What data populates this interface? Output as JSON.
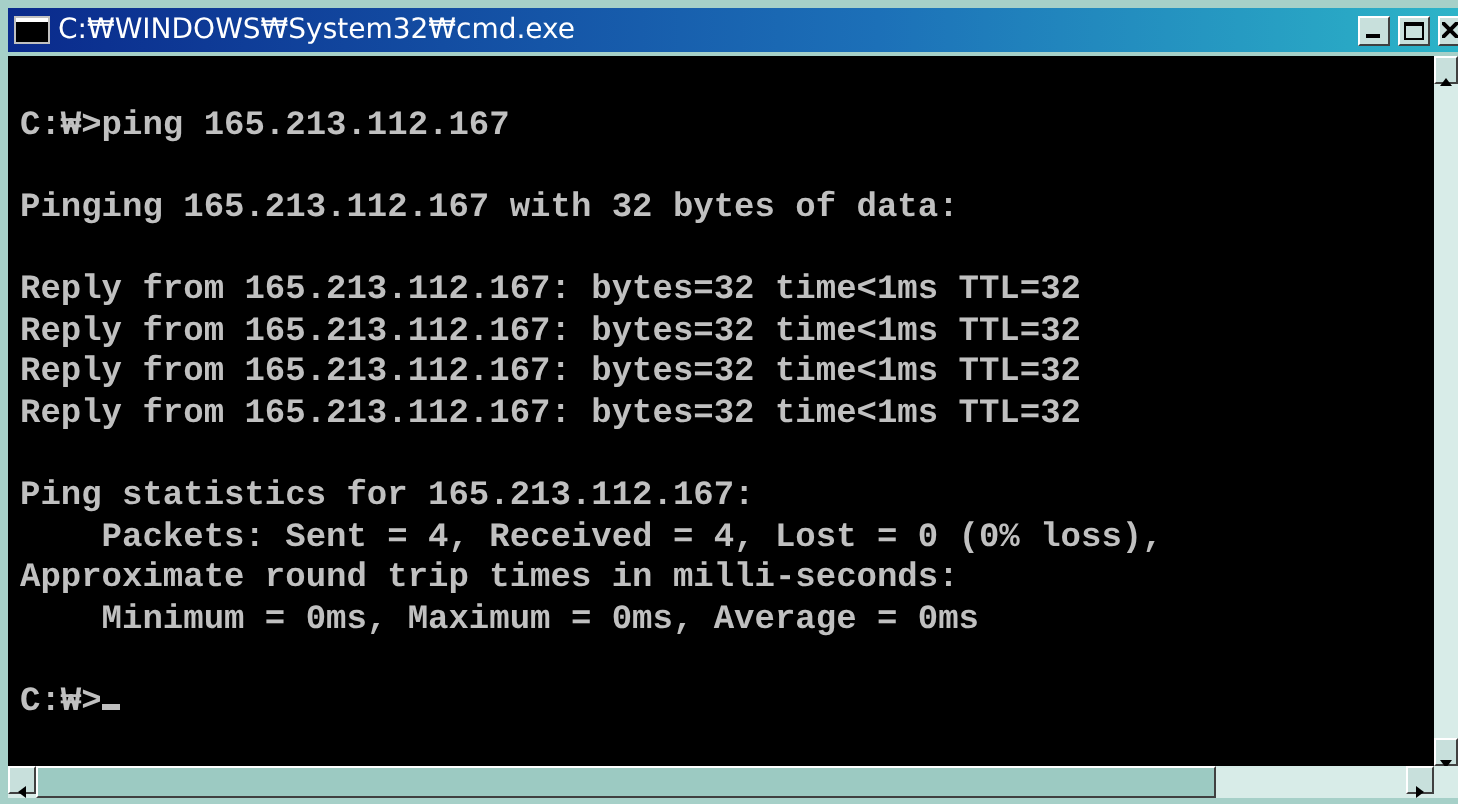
{
  "window": {
    "title": "C:₩WINDOWS₩System32₩cmd.exe"
  },
  "console": {
    "blocks": [
      {
        "lines": [
          "C:₩>ping 165.213.112.167"
        ]
      },
      {
        "lines": [
          "Pinging 165.213.112.167 with 32 bytes of data:"
        ]
      },
      {
        "lines": [
          "Reply from 165.213.112.167: bytes=32 time<1ms TTL=32",
          "Reply from 165.213.112.167: bytes=32 time<1ms TTL=32",
          "Reply from 165.213.112.167: bytes=32 time<1ms TTL=32",
          "Reply from 165.213.112.167: bytes=32 time<1ms TTL=32"
        ]
      },
      {
        "lines": [
          "Ping statistics for 165.213.112.167:",
          "    Packets: Sent = 4, Received = 4, Lost = 0 (0% loss),",
          "Approximate round trip times in milli-seconds:",
          "    Minimum = 0ms, Maximum = 0ms, Average = 0ms"
        ]
      }
    ],
    "prompt": "C:₩>"
  }
}
